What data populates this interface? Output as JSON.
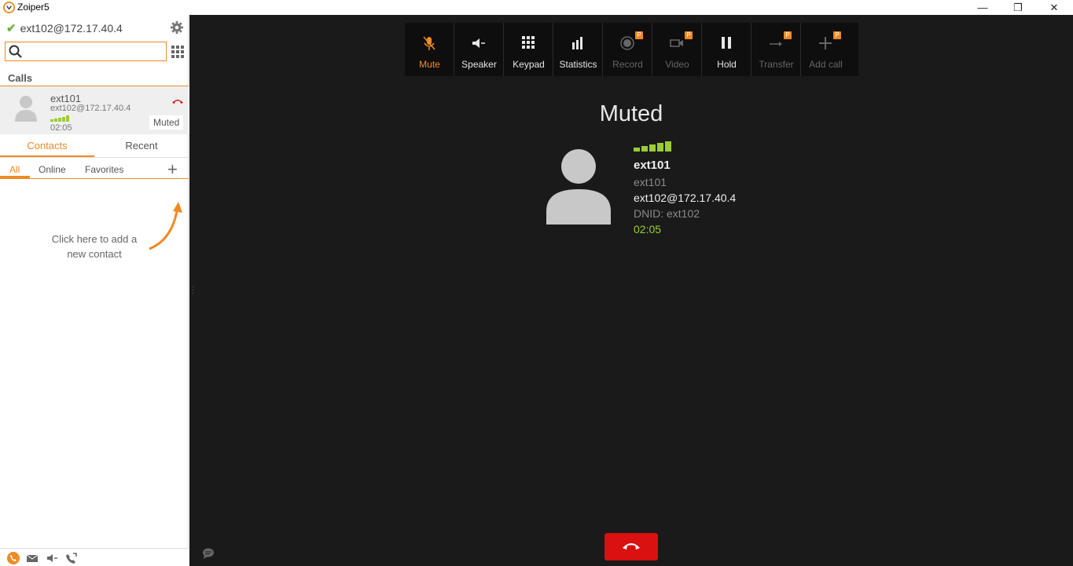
{
  "window": {
    "title": "Zoiper5",
    "minimize": "—",
    "restore": "❐",
    "close": "✕"
  },
  "sidebar": {
    "account": "ext102@172.17.40.4",
    "account_status": "online",
    "search": {
      "value": "",
      "placeholder": ""
    },
    "calls_header": "Calls",
    "call": {
      "name": "ext101",
      "address": "ext102@172.17.40.4",
      "duration": "02:05",
      "badge": "Muted"
    },
    "tabs": [
      {
        "label": "Contacts",
        "active": true
      },
      {
        "label": "Recent",
        "active": false
      }
    ],
    "subtabs": [
      "All",
      "Online",
      "Favorites"
    ],
    "hint": "Click here to add a new contact",
    "bottom_icons": [
      "phone-icon",
      "mail-icon",
      "speaker-icon",
      "call-forward-icon"
    ]
  },
  "toolbar": {
    "buttons": [
      {
        "label": "Mute",
        "icon": "mic-muted-icon",
        "state": "active"
      },
      {
        "label": "Speaker",
        "icon": "speaker-icon",
        "state": "normal"
      },
      {
        "label": "Keypad",
        "icon": "keypad-icon",
        "state": "normal"
      },
      {
        "label": "Statistics",
        "icon": "statistics-icon",
        "state": "normal"
      },
      {
        "label": "Record",
        "icon": "record-icon",
        "state": "disabled",
        "badge": "P"
      },
      {
        "label": "Video",
        "icon": "video-icon",
        "state": "disabled",
        "badge": "P"
      },
      {
        "label": "Hold",
        "icon": "pause-icon",
        "state": "normal"
      },
      {
        "label": "Transfer",
        "icon": "transfer-icon",
        "state": "disabled",
        "badge": "P"
      },
      {
        "label": "Add call",
        "icon": "add-call-icon",
        "state": "disabled",
        "badge": "P"
      }
    ]
  },
  "active_call": {
    "status": "Muted",
    "name": "ext101",
    "display_name": "ext101",
    "address": "ext102@172.17.40.4",
    "dnid": "DNID: ext102",
    "duration": "02:05",
    "signal_bars": 5
  },
  "colors": {
    "accent": "#f08a24",
    "hangup": "#d91111",
    "signal": "#9acd32",
    "main_bg": "#1a1a1a"
  }
}
